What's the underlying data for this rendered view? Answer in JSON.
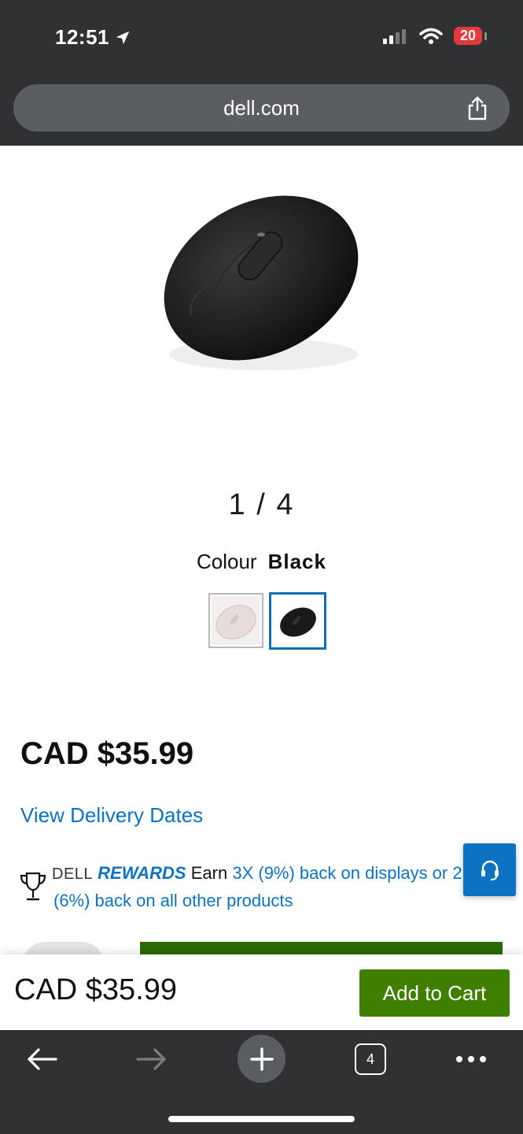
{
  "status_bar": {
    "time": "12:51",
    "battery": "20"
  },
  "browser": {
    "url": "dell.com"
  },
  "product": {
    "image_pager": "1 / 4",
    "colour_label": "Colour",
    "colour_value": "Black",
    "swatches": [
      "white-mouse-swatch",
      "black-mouse-swatch"
    ],
    "price": "CAD $35.99",
    "delivery_link": "View Delivery Dates"
  },
  "rewards": {
    "brand": "DELL",
    "program": "REWARDS",
    "earn": "Earn",
    "line1_link": "3X (9%) back on displays or 2",
    "line2_link": "(6%) back on all other products"
  },
  "sticky_bar": {
    "price": "CAD $35.99",
    "add_to_cart": "Add to Cart"
  },
  "toolbar": {
    "tabs_count": "4"
  },
  "colors": {
    "chrome": "#2f3133",
    "link_blue": "#0e72c2",
    "cart_green": "#3f7f00",
    "selected_swatch": "#0e6fb5"
  }
}
